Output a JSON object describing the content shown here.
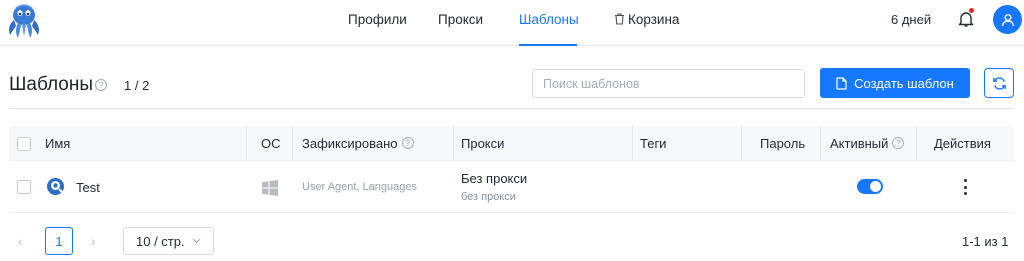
{
  "nav": {
    "items": [
      {
        "label": "Профили",
        "active": false
      },
      {
        "label": "Прокси",
        "active": false
      },
      {
        "label": "Шаблоны",
        "active": true
      },
      {
        "label": "Корзина",
        "active": false,
        "icon": "trash-icon"
      }
    ],
    "days_left": "6 дней",
    "notifications_icon": "bell-icon",
    "avatar_icon": "user-icon",
    "accent_color": "#1677ff"
  },
  "page": {
    "title": "Шаблоны",
    "count": "1 / 2",
    "search_placeholder": "Поиск шаблонов",
    "create_button": "Создать шаблон"
  },
  "table": {
    "columns": [
      "Имя",
      "ОС",
      "Зафиксировано",
      "Прокси",
      "Теги",
      "Пароль",
      "Активный",
      "Действия"
    ],
    "rows": [
      {
        "name": "Test",
        "os_icon": "windows-icon",
        "fixed": "User Agent, Languages",
        "proxy": "Без прокси",
        "proxy_sub": "без прокси",
        "tags": "",
        "password": "",
        "active": true
      }
    ]
  },
  "pagination": {
    "current_page": "1",
    "page_size": "10 / стр.",
    "total": "1-1 из 1"
  }
}
